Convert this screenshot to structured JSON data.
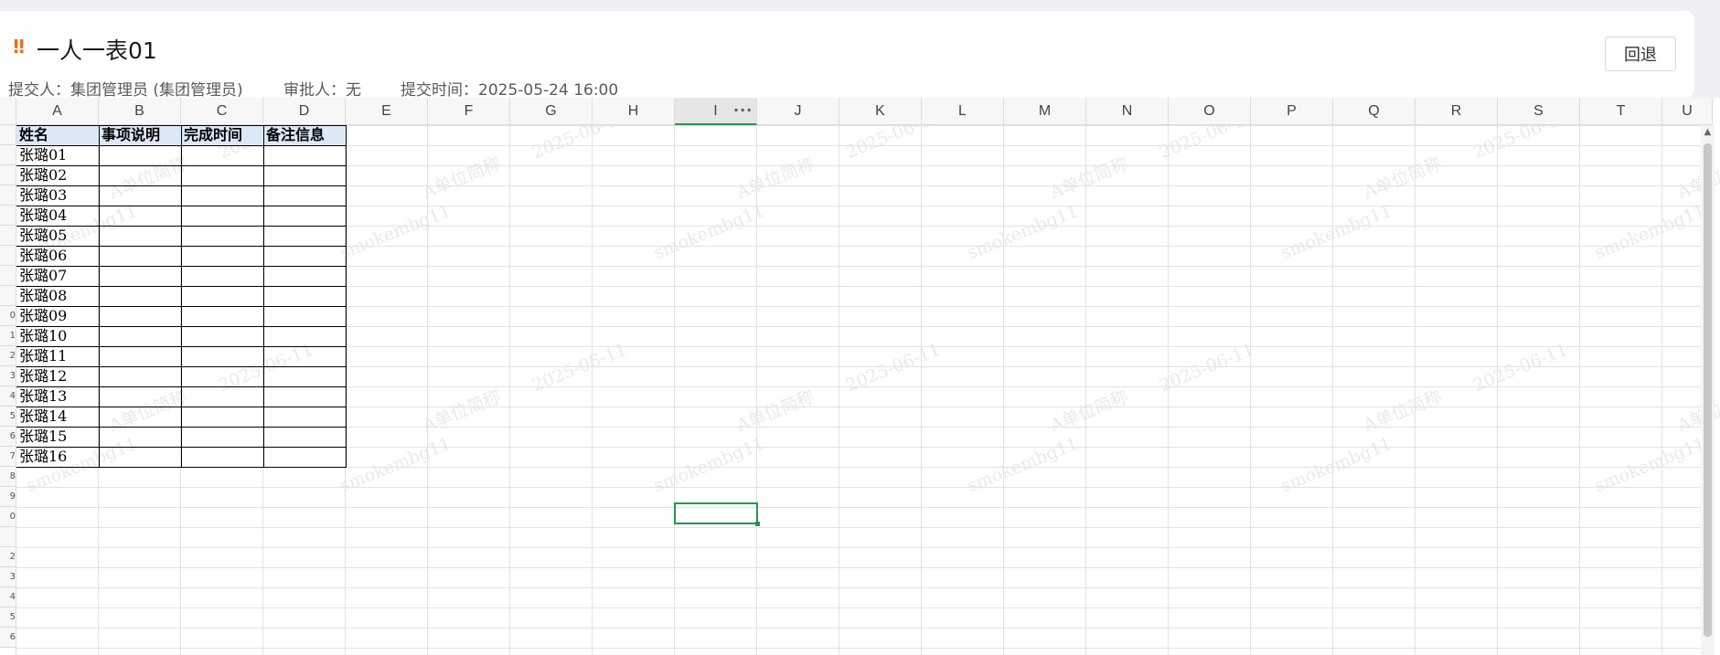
{
  "header": {
    "title": "一人一表01",
    "submitter_label": "提交人：集团管理员 (集团管理员)",
    "approver_label": "审批人：无",
    "submit_time_label": "提交时间：2025-05-24 16:00",
    "back_button": "回退",
    "warn_icon": "!!"
  },
  "sheet": {
    "columns": [
      "A",
      "B",
      "C",
      "D",
      "E",
      "F",
      "G",
      "H",
      "I",
      "J",
      "K",
      "L",
      "M",
      "N",
      "O",
      "P",
      "Q",
      "R",
      "S",
      "T",
      "U"
    ],
    "active_column": "I",
    "column_menu_icon": "···",
    "row_numbers": [
      "",
      "",
      "",
      "",
      "",
      "",
      "",
      "",
      "",
      "0",
      "1",
      "2",
      "3",
      "4",
      "5",
      "6",
      "7",
      "8",
      "9",
      "0",
      "",
      "2",
      "3",
      "4",
      "5",
      "6"
    ],
    "table_headers": [
      "姓名",
      "事项说明",
      "完成时间",
      "备注信息"
    ],
    "names": [
      "张璐01",
      "张璐02",
      "张璐03",
      "张璐04",
      "张璐05",
      "张璐06",
      "张璐07",
      "张璐08",
      "张璐09",
      "张璐10",
      "张璐11",
      "张璐12",
      "张璐13",
      "张璐14",
      "张璐15",
      "张璐16"
    ],
    "watermark": {
      "org": "A单位简称",
      "user": "smokembg11",
      "date": "2025-06-11"
    }
  },
  "colors": {
    "accent_green": "#1d9a4e",
    "warn_orange": "#f06a1f",
    "table_header_bg": "#dde8f7"
  }
}
